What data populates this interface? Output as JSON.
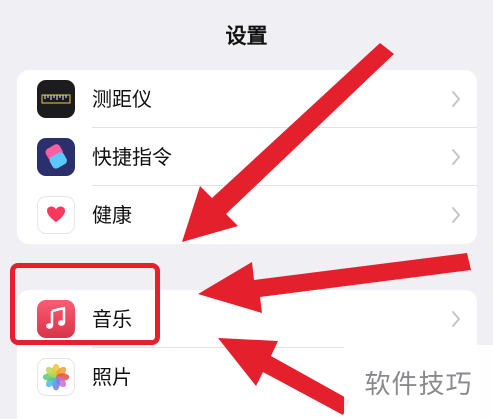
{
  "header": {
    "title": "设置"
  },
  "settings_group_1": [
    {
      "label": "测距仪",
      "icon": "measure-icon"
    },
    {
      "label": "快捷指令",
      "icon": "shortcuts-icon"
    },
    {
      "label": "健康",
      "icon": "health-icon"
    }
  ],
  "settings_group_2": [
    {
      "label": "音乐",
      "icon": "music-icon"
    },
    {
      "label": "照片",
      "icon": "photos-icon"
    }
  ],
  "annotation": {
    "arrow_color": "#e3202b",
    "highlight_color": "#e3202b"
  },
  "watermark": {
    "text": "软件技巧"
  }
}
